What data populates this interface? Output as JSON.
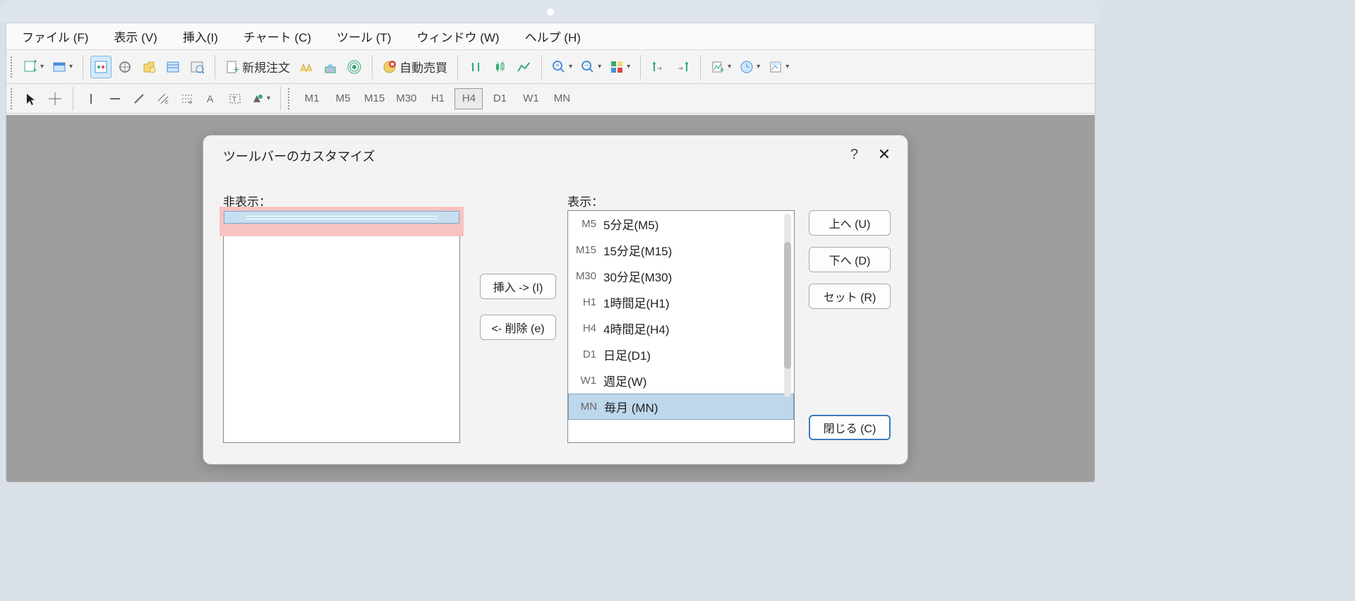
{
  "menubar": [
    "ファイル (F)",
    "表示 (V)",
    "挿入(I)",
    "チャート (C)",
    "ツール (T)",
    "ウィンドウ (W)",
    "ヘルプ (H)"
  ],
  "toolbar": {
    "new_order": "新規注文",
    "auto_trade": "自動売買"
  },
  "timeframes": [
    "M1",
    "M5",
    "M15",
    "M30",
    "H1",
    "H4",
    "D1",
    "W1",
    "MN"
  ],
  "dialog": {
    "title": "ツールバーのカスタマイズ",
    "help": "?",
    "close_icon": "✕",
    "hidden_label": "非表示：",
    "shown_label": "表示：",
    "insert_btn": "挿入 -> (I)",
    "delete_btn": "<- 削除 (e)",
    "up_btn": "上へ (U)",
    "down_btn": "下へ (D)",
    "set_btn": "セット (R)",
    "close_btn": "閉じる (C)",
    "shown_items": [
      {
        "code": "M5",
        "label": "5分足(M5)"
      },
      {
        "code": "M15",
        "label": "15分足(M15)"
      },
      {
        "code": "M30",
        "label": "30分足(M30)"
      },
      {
        "code": "H1",
        "label": "1時間足(H1)"
      },
      {
        "code": "H4",
        "label": "4時間足(H4)"
      },
      {
        "code": "D1",
        "label": "日足(D1)"
      },
      {
        "code": "W1",
        "label": "週足(W)"
      },
      {
        "code": "MN",
        "label": "毎月 (MN)"
      }
    ],
    "selected_index": 7
  }
}
